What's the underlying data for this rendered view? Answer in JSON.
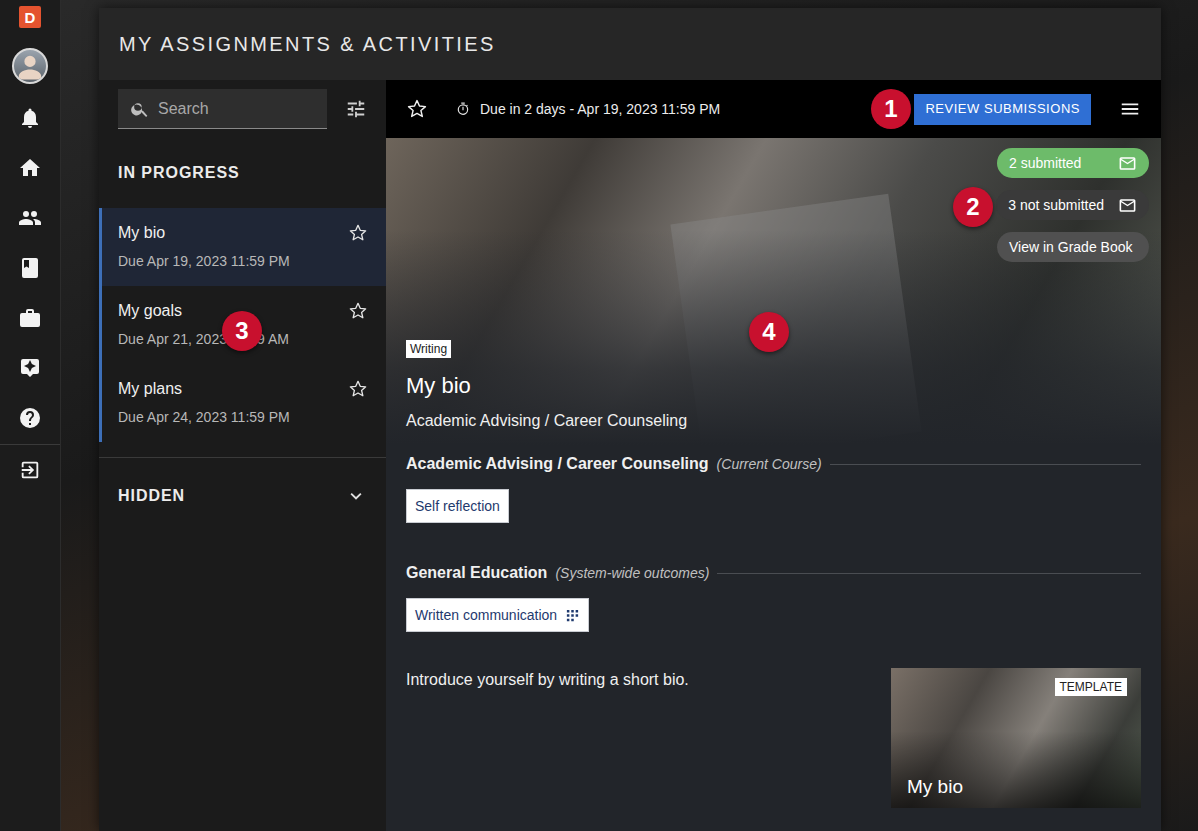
{
  "app": {
    "logo": "D"
  },
  "header": {
    "title": "MY ASSIGNMENTS & ACTIVITIES"
  },
  "search": {
    "placeholder": "Search"
  },
  "sections": {
    "in_progress": {
      "label": "IN PROGRESS",
      "items": [
        {
          "title": "My bio",
          "due": "Due Apr 19, 2023 11:59 PM",
          "selected": true,
          "starred": false
        },
        {
          "title": "My goals",
          "due": "Due Apr 21, 2023 11:59 AM",
          "selected": false,
          "starred": false
        },
        {
          "title": "My plans",
          "due": "Due Apr 24, 2023 11:59 PM",
          "selected": false,
          "starred": false
        }
      ]
    },
    "hidden": {
      "label": "HIDDEN",
      "expanded": false
    }
  },
  "toolbar": {
    "starred": false,
    "due": "Due in 2 days - Apr 19, 2023 11:59 PM",
    "review_button": "REVIEW SUBMISSIONS"
  },
  "status_pills": [
    {
      "label": "2 submitted",
      "kind": "mail",
      "color": "#6dbb6a"
    },
    {
      "label": "3 not submitted",
      "kind": "mail",
      "color": "#3a3a3a"
    },
    {
      "label": "View in Grade Book",
      "kind": "link",
      "color": "#505050"
    }
  ],
  "assignment": {
    "tag": "Writing",
    "title": "My bio",
    "course": "Academic Advising / Career Counseling",
    "outcome_groups": [
      {
        "name": "Academic Advising / Career Counseling",
        "note": "(Current Course)",
        "outcomes": [
          {
            "label": "Self reflection",
            "rubric": false
          }
        ]
      },
      {
        "name": "General Education",
        "note": "(System-wide outcomes)",
        "outcomes": [
          {
            "label": "Written communication",
            "rubric": true
          }
        ]
      }
    ],
    "description": "Introduce yourself by writing a short bio.",
    "template": {
      "badge": "TEMPLATE",
      "title": "My bio"
    }
  },
  "callouts": [
    {
      "label": "1"
    },
    {
      "label": "2"
    },
    {
      "label": "3"
    },
    {
      "label": "4"
    }
  ]
}
